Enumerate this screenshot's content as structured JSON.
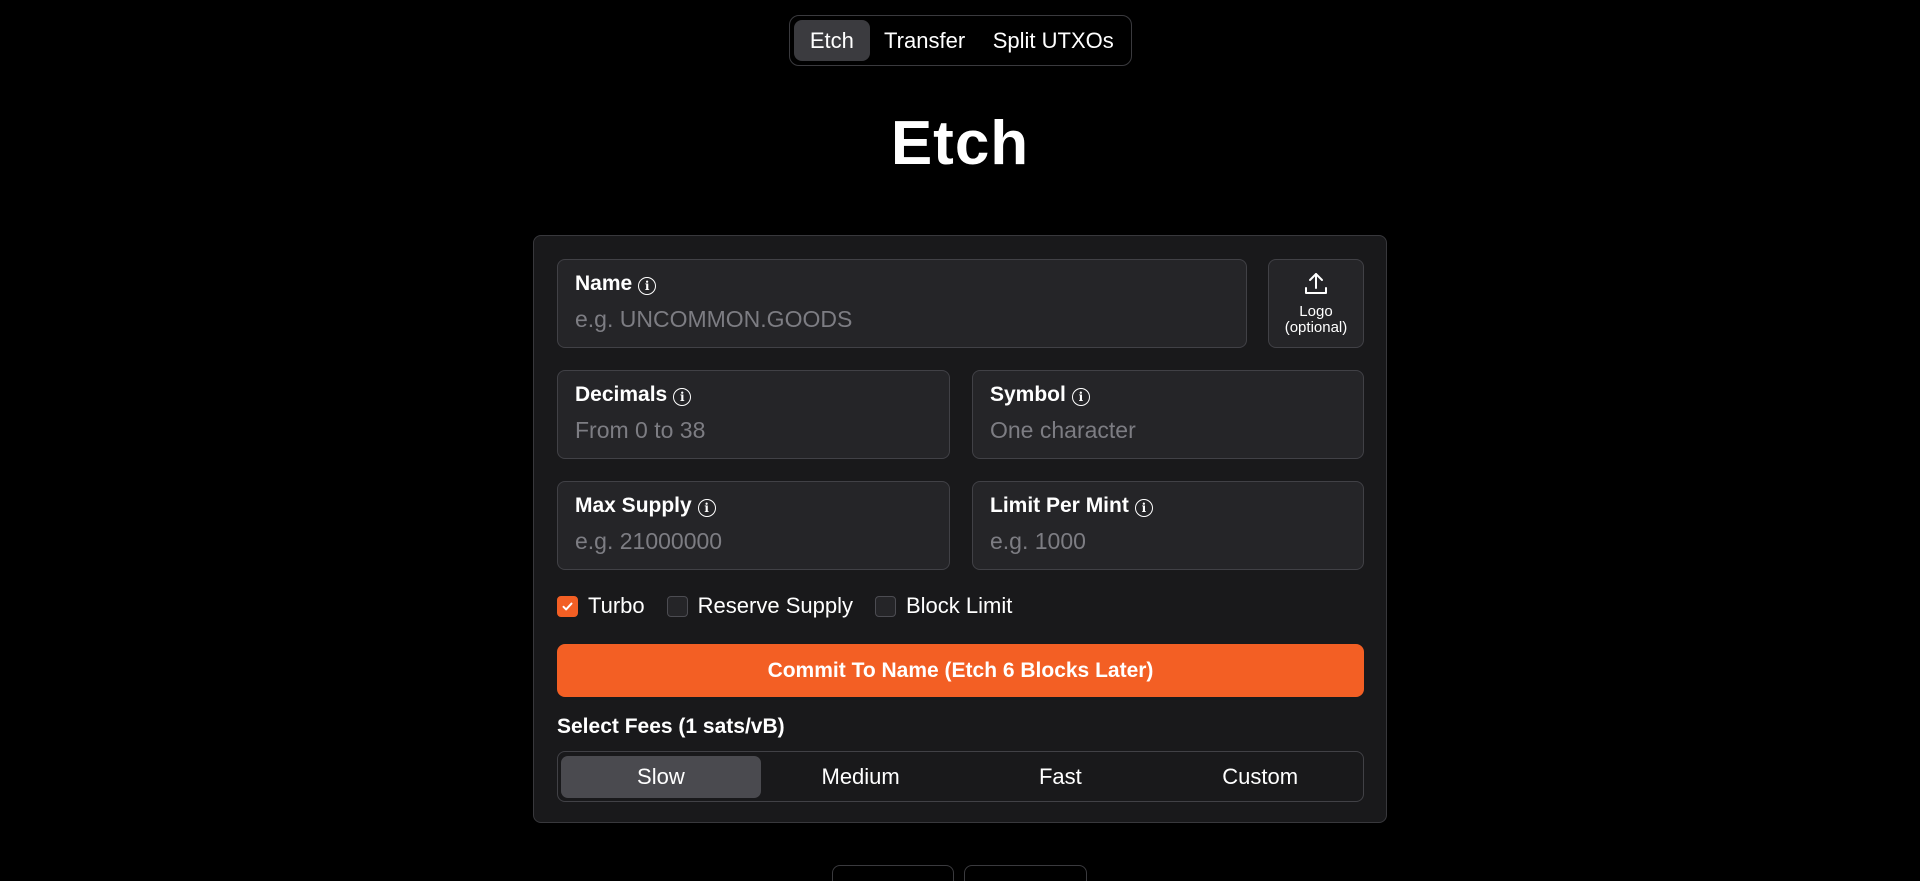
{
  "tabs": [
    {
      "label": "Etch",
      "active": true
    },
    {
      "label": "Transfer",
      "active": false
    },
    {
      "label": "Split UTXOs",
      "active": false
    }
  ],
  "page_title": "Etch",
  "form": {
    "name": {
      "label": "Name",
      "placeholder": "e.g. UNCOMMON.GOODS",
      "value": ""
    },
    "logo": {
      "line1": "Logo",
      "line2": "(optional)",
      "icon": "upload-icon"
    },
    "decimals": {
      "label": "Decimals",
      "placeholder": "From 0 to 38",
      "value": ""
    },
    "symbol": {
      "label": "Symbol",
      "placeholder": "One character",
      "value": ""
    },
    "max_supply": {
      "label": "Max Supply",
      "placeholder": "e.g. 21000000",
      "value": ""
    },
    "limit_per_mint": {
      "label": "Limit Per Mint",
      "placeholder": "e.g. 1000",
      "value": ""
    },
    "info_icon": "i",
    "options": [
      {
        "label": "Turbo",
        "checked": true
      },
      {
        "label": "Reserve Supply",
        "checked": false
      },
      {
        "label": "Block Limit",
        "checked": false
      }
    ],
    "commit_label": "Commit To Name (Etch 6 Blocks Later)",
    "fees_label": "Select Fees (1 sats/vB)",
    "fees": [
      {
        "label": "Slow",
        "active": true
      },
      {
        "label": "Medium",
        "active": false
      },
      {
        "label": "Fast",
        "active": false
      },
      {
        "label": "Custom",
        "active": false
      }
    ]
  },
  "colors": {
    "accent": "#f35f24",
    "background": "#000000",
    "card": "#19191b",
    "field": "#252528",
    "placeholder": "#7d7d83"
  }
}
